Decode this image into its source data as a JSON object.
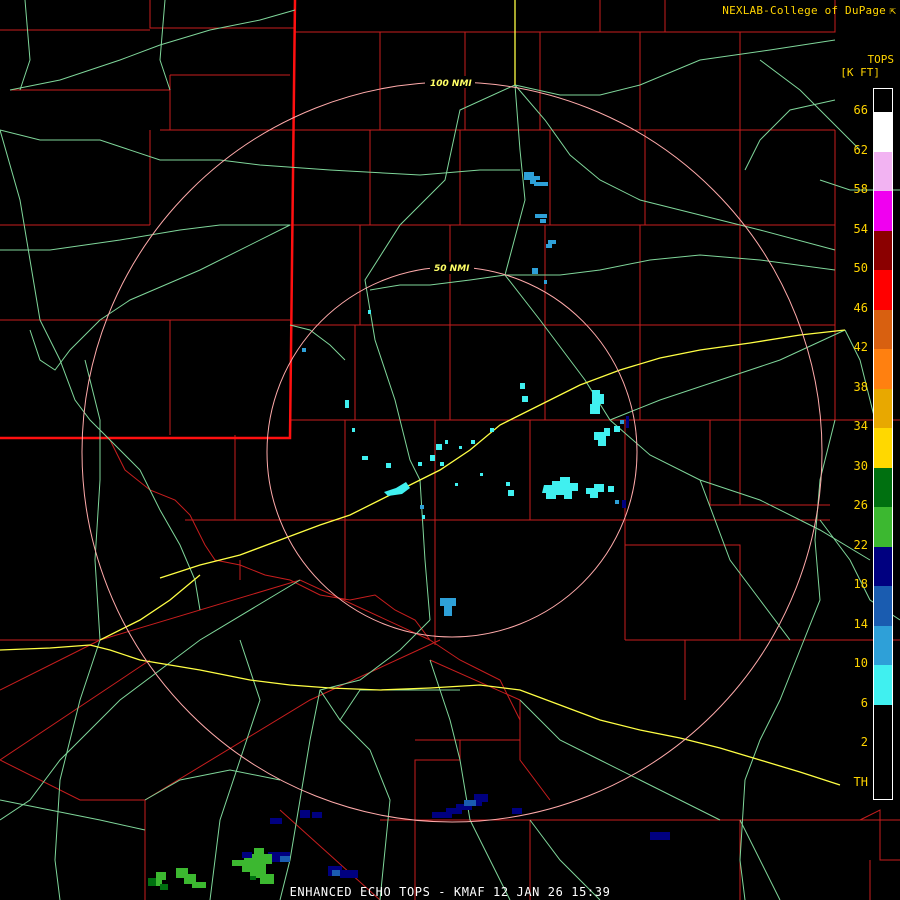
{
  "credit": {
    "text": "NEXLAB-College of DuPage",
    "icon": "cursor-arrow-icon"
  },
  "legend": {
    "title_line1": "TOPS",
    "title_line2": "[K FT]",
    "ticks": [
      "66",
      "62",
      "58",
      "54",
      "50",
      "46",
      "42",
      "38",
      "34",
      "30",
      "26",
      "22",
      "18",
      "14",
      "10",
      "6",
      "2",
      "TH"
    ],
    "colors": [
      "#ffffff",
      "#f2b3f2",
      "#f000f0",
      "#8b0000",
      "#ff0000",
      "#d86010",
      "#ff8010",
      "#e8a800",
      "#ffd800",
      "#007010",
      "#3cb830",
      "#000080",
      "#1a5cb0",
      "#2ea0d8",
      "#40f0f0"
    ]
  },
  "range_rings": [
    {
      "label": "100 NMI"
    },
    {
      "label": "50 NMI"
    }
  ],
  "footer": {
    "text": "ENHANCED ECHO TOPS - KMAF 12 JAN 26 15:39"
  },
  "colors": {
    "background": "#000000",
    "county_lines": "#d42020",
    "state_line": "#ff1010",
    "roads": "#7fd69a",
    "interstates": "#ffff44",
    "range_rings": "#ffaaaa",
    "text": "#ffd400"
  }
}
